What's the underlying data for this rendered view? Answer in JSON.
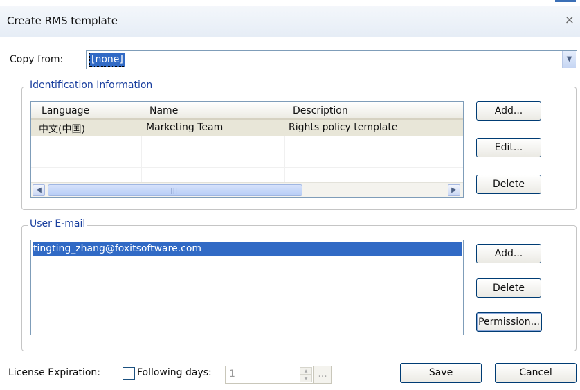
{
  "window": {
    "title": "Create RMS template",
    "close_glyph": "×"
  },
  "copy_from": {
    "label": "Copy from:",
    "value": "[none]",
    "dropdown_glyph": "▼"
  },
  "identification": {
    "legend": "Identification Information",
    "columns": [
      "Language",
      "Name",
      "Description"
    ],
    "rows": [
      {
        "language": "中文(中国)",
        "name": "Marketing Team",
        "description": "Rights policy template"
      }
    ],
    "buttons": {
      "add": "Add...",
      "edit": "Edit...",
      "delete": "Delete"
    },
    "scroll": {
      "left_glyph": "◀",
      "right_glyph": "▶",
      "grip": "|||"
    }
  },
  "user_email": {
    "legend": "User E-mail",
    "emails": [
      "tingting_zhang@foxitsoftware.com"
    ],
    "buttons": {
      "add": "Add...",
      "delete": "Delete",
      "permission": "Permission..."
    }
  },
  "license": {
    "label": "License Expiration:",
    "checkbox_label": "Following days:",
    "checked": false,
    "days_value": "1",
    "spin_up": "▲",
    "spin_down": "▼",
    "ellipsis": "..."
  },
  "footer": {
    "save": "Save",
    "cancel": "Cancel"
  }
}
